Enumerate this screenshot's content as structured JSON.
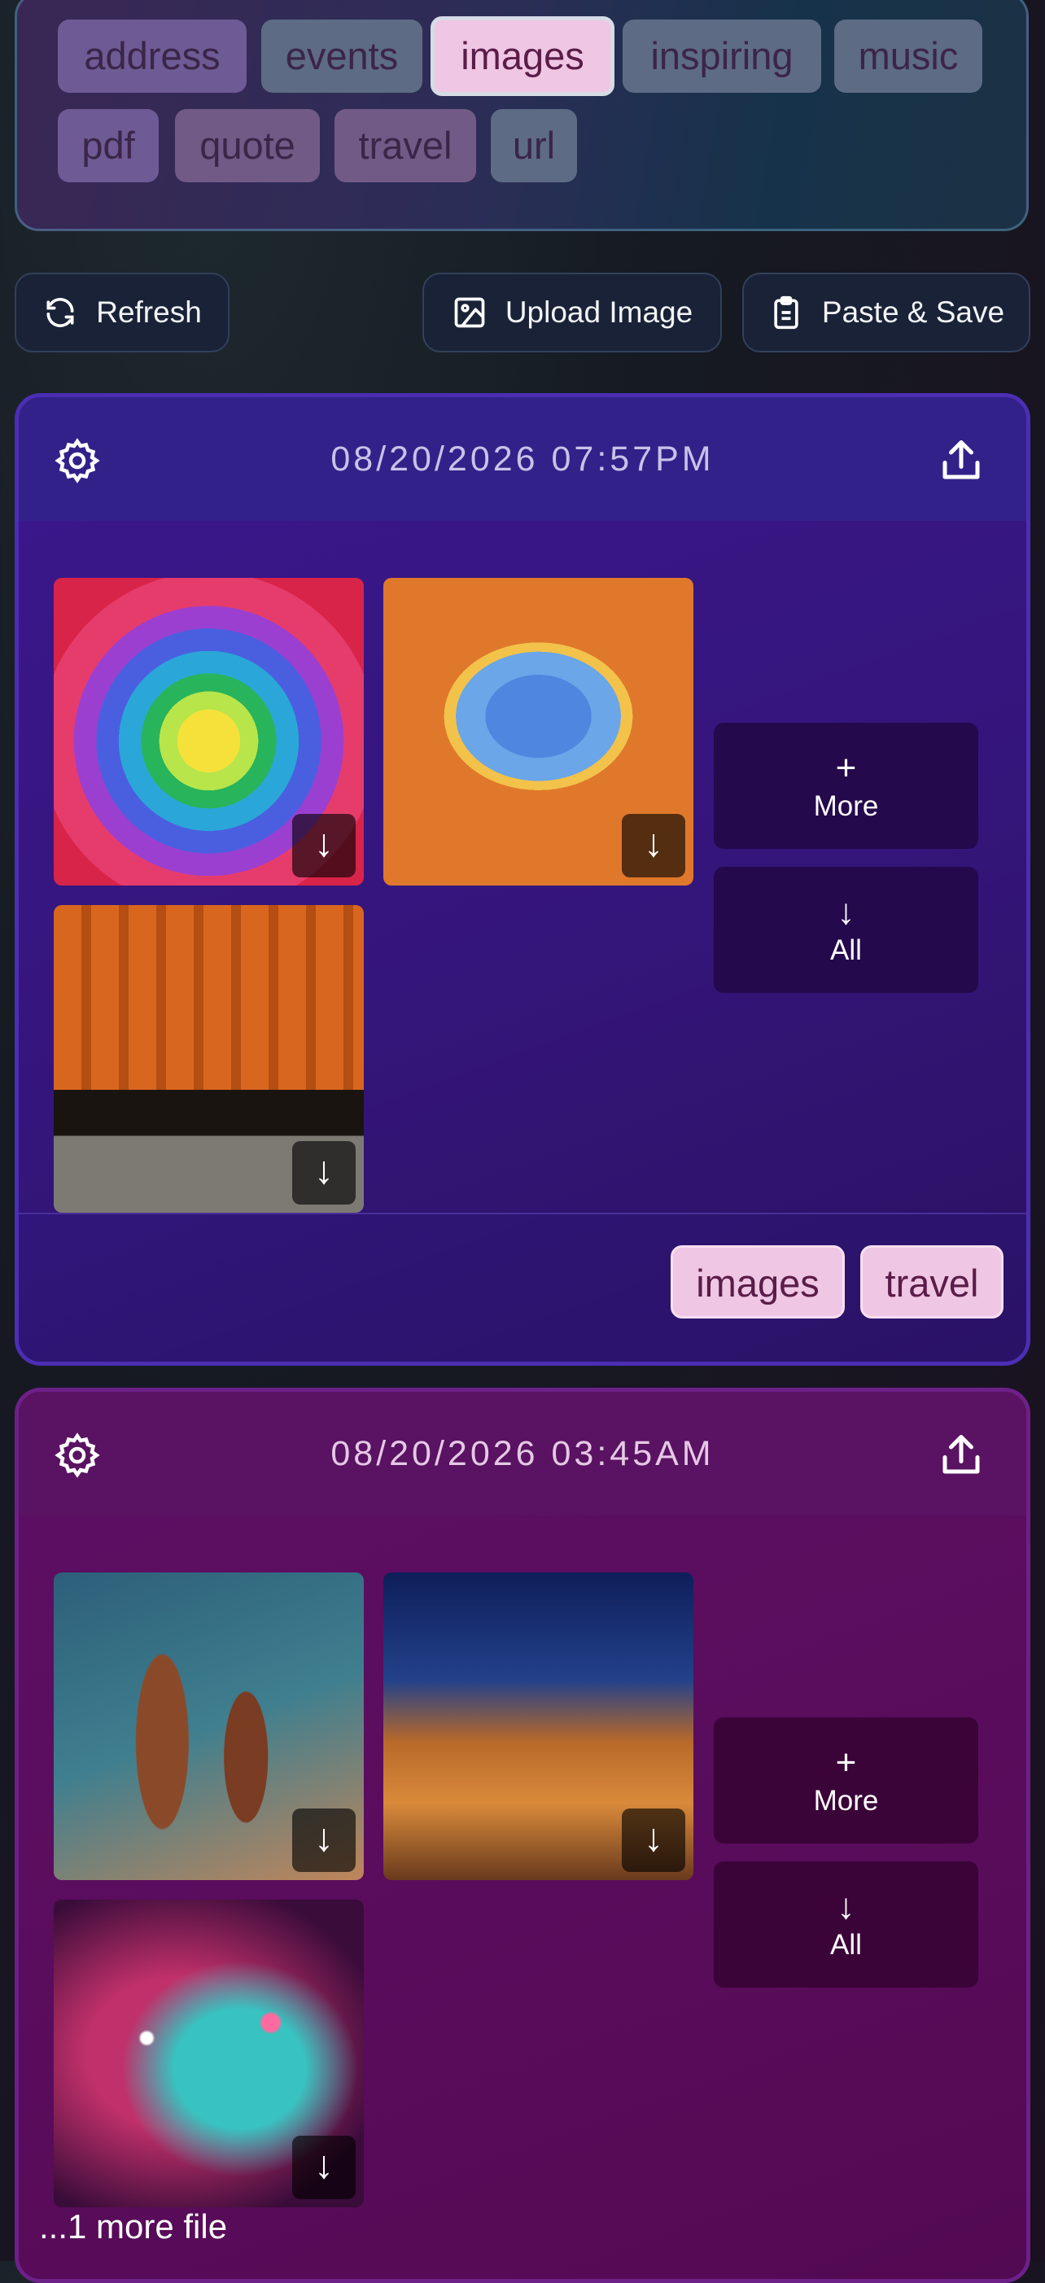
{
  "tags": [
    {
      "label": "address",
      "active": false
    },
    {
      "label": "events",
      "active": false
    },
    {
      "label": "images",
      "active": true
    },
    {
      "label": "inspiring",
      "active": false
    },
    {
      "label": "music",
      "active": false
    },
    {
      "label": "pdf",
      "active": false
    },
    {
      "label": "quote",
      "active": false
    },
    {
      "label": "travel",
      "active": false
    },
    {
      "label": "url",
      "active": false
    }
  ],
  "toolbar": {
    "refresh_label": "Refresh",
    "upload_label": "Upload Image",
    "paste_label": "Paste & Save"
  },
  "cards": [
    {
      "timestamp": "08/20/2026 07:57PM",
      "images": [
        "hot-air-balloon-interior",
        "grand-prismatic-spring",
        "torii-gate-path"
      ],
      "more_label": "More",
      "all_label": "All",
      "tags": [
        "images",
        "travel"
      ]
    },
    {
      "timestamp": "08/20/2026 03:45AM",
      "images": [
        "pillars-of-creation",
        "cosmic-cliffs",
        "nebula-star-field"
      ],
      "more_label": "More",
      "all_label": "All",
      "more_files": "...1 more file"
    }
  ],
  "icons": {
    "download": "↓",
    "plus": "+",
    "all_arrow": "↓"
  },
  "colors": {
    "active_tag": "#efc6e3",
    "card1": "#2a1472",
    "card2": "#4e0c4e"
  }
}
